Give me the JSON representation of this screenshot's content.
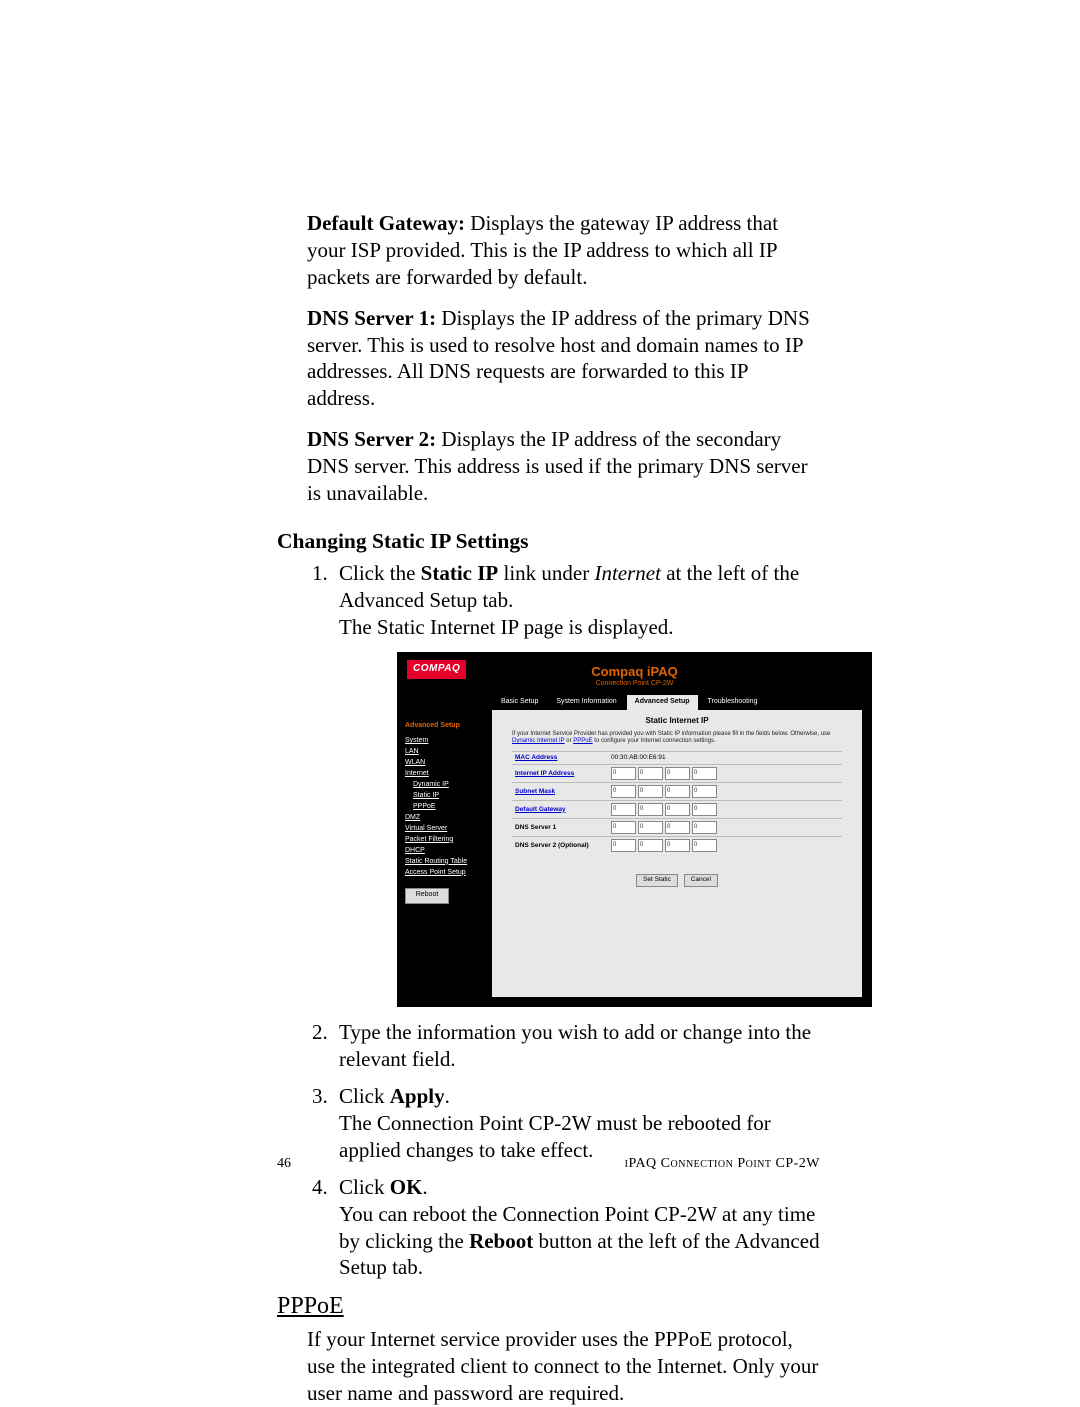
{
  "para1": {
    "label": "Default Gateway:",
    "text": " Displays the gateway IP address that your ISP provided. This is the IP address to which all IP packets are forwarded by default."
  },
  "para2": {
    "label": "DNS Server 1:",
    "text": " Displays the IP address of the primary DNS server. This is used to resolve host and domain names to IP addresses. All DNS requests are forwarded to this IP address."
  },
  "para3": {
    "label": "DNS Server 2:",
    "text": " Displays the IP address of the secondary DNS server. This address is used if the primary DNS server is unavailable."
  },
  "heading1": "Changing Static IP Settings",
  "steps": {
    "s1a": "Click the ",
    "s1b": "Static IP",
    "s1c": " link under ",
    "s1d": "Internet",
    "s1e": " at the left of the Advanced Setup tab.",
    "s1f": "The Static Internet IP page is displayed.",
    "s2": "Type the information you wish to add or change into the relevant field.",
    "s3a": "Click ",
    "s3b": "Apply",
    "s3c": ".",
    "s3d": "The Connection Point CP-2W must be rebooted for applied changes to take effect.",
    "s4a": "Click ",
    "s4b": "OK",
    "s4c": ".",
    "s4d": "You can reboot the Connection Point CP-2W at any time by clicking the ",
    "s4e": "Reboot",
    "s4f": " button at the left of the Advanced Setup tab."
  },
  "heading2": "PPPoE",
  "pppoe_text": "If your Internet service provider uses the PPPoE protocol, use the integrated client to connect to the Internet. Only your user name and password are required.",
  "footer": {
    "page": "46",
    "title": "iPAQ Connection Point CP-2W"
  },
  "shot": {
    "logo": "COMPAQ",
    "title1": "Compaq iPAQ",
    "title2": "Connection Point CP-2W",
    "tabs": [
      "Basic Setup",
      "System Information",
      "Advanced Setup",
      "Troubleshooting"
    ],
    "side_head": "Advanced Setup",
    "side_items": [
      "System",
      "LAN",
      "WLAN",
      "Internet",
      "Dynamic IP",
      "Static IP",
      "PPPoE",
      "DMZ",
      "Virtual Server",
      "Packet Filtering",
      "DHCP",
      "Static Routing Table",
      "Access Point Setup"
    ],
    "reboot": "Reboot",
    "content_head": "Static Internet IP",
    "note_a": "If your Internet Service Provider has provided you with Static IP information please fill in the fields below. Otherwise, use ",
    "note_link1": "Dynamic Internet IP",
    "note_b": " or ",
    "note_link2": "PPPoE",
    "note_c": " to configure your Internet connection settings.",
    "rows": [
      {
        "label": "MAC Address",
        "link": true,
        "value": "00:30:AB:00:E6:91"
      },
      {
        "label": "Internet IP Address",
        "link": true,
        "ip": [
          "0",
          "0",
          "0",
          "0"
        ]
      },
      {
        "label": "Subnet Mask",
        "link": true,
        "ip": [
          "0",
          "0",
          "0",
          "0"
        ]
      },
      {
        "label": "Default Gateway",
        "link": true,
        "ip": [
          "0",
          "0",
          "0",
          "0"
        ]
      },
      {
        "label": "DNS Server 1",
        "link": false,
        "ip": [
          "0",
          "0",
          "0",
          "0"
        ]
      },
      {
        "label": "DNS Server 2 (Optional)",
        "link": false,
        "ip": [
          "0",
          "0",
          "0",
          "0"
        ]
      }
    ],
    "btn1": "Set Static",
    "btn2": "Cancel"
  }
}
